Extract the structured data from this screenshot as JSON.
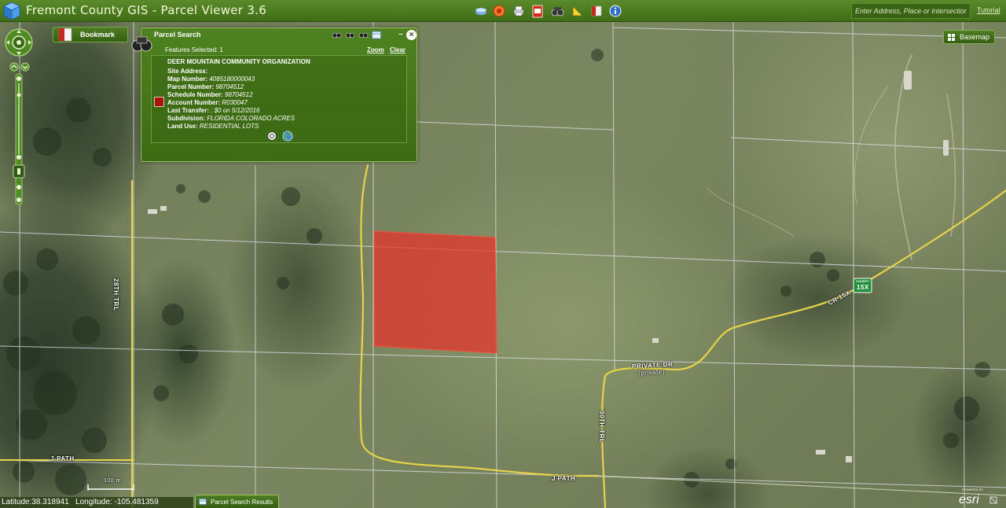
{
  "app": {
    "title": "Fremont County GIS - Parcel Viewer 3.6",
    "toolbar_icons": [
      "layers-icon",
      "record-icon",
      "print-icon",
      "pdf-icon",
      "identify-icon",
      "measure-icon",
      "bookmark-icon",
      "info-icon"
    ],
    "search_placeholder": "Enter Address, Place or Intersection",
    "tutorial_label": "Tutorial",
    "accent_color": "#4a7c1c"
  },
  "bookmark": {
    "label": "Bookmark"
  },
  "basemap": {
    "label": "Basemap"
  },
  "parcel_search": {
    "title": "Parcel Search",
    "features_selected": "Features Selected: 1",
    "zoom_label": "Zoom",
    "clear_label": "Clear",
    "result": {
      "owner": "DEER MOUNTAIN COMMUNITY ORGANIZATION",
      "site_address_label": "Site Address:",
      "site_address_value": "",
      "map_number_label": "Map Number:",
      "map_number_value": "4085180000043",
      "parcel_number_label": "Parcel Number:",
      "parcel_number_value": "98704512",
      "schedule_number_label": "Schedule Number:",
      "schedule_number_value": "98704512",
      "account_number_label": "Account Number:",
      "account_number_value": "R030047",
      "last_transfer_label": "Last Transfer:",
      "last_transfer_value": ": $0 on 5/12/2016",
      "subdivision_label": "Subdivision:",
      "subdivision_value": "FLORIDA COLORADO ACRES",
      "land_use_label": "Land Use:",
      "land_use_value": "RESIDENTIAL LOTS",
      "swatch_color": "#a8140c"
    }
  },
  "map": {
    "selected_parcel_color": "#e8302a",
    "road_labels": {
      "trl_28th": "28TH TRL",
      "trl_30th": "30TH TRL",
      "cr_15x": "CR 15X",
      "private_dr": "PRIVATE DR",
      "private_sub": "(private)",
      "j_path_left": "J-PATH",
      "j_path_bottom": "J PATH",
      "county_sign_top": "COUNTY",
      "county_sign": "15X"
    },
    "scale_label": "100 m"
  },
  "status": {
    "latitude_label": "Latitude:",
    "latitude_value": "38.318941",
    "longitude_label": "Longitude:",
    "longitude_value": "-105.481359",
    "results_tab_label": "Parcel Search Results"
  },
  "attribution": {
    "powered_by": "POWERED BY",
    "brand": "esri"
  }
}
